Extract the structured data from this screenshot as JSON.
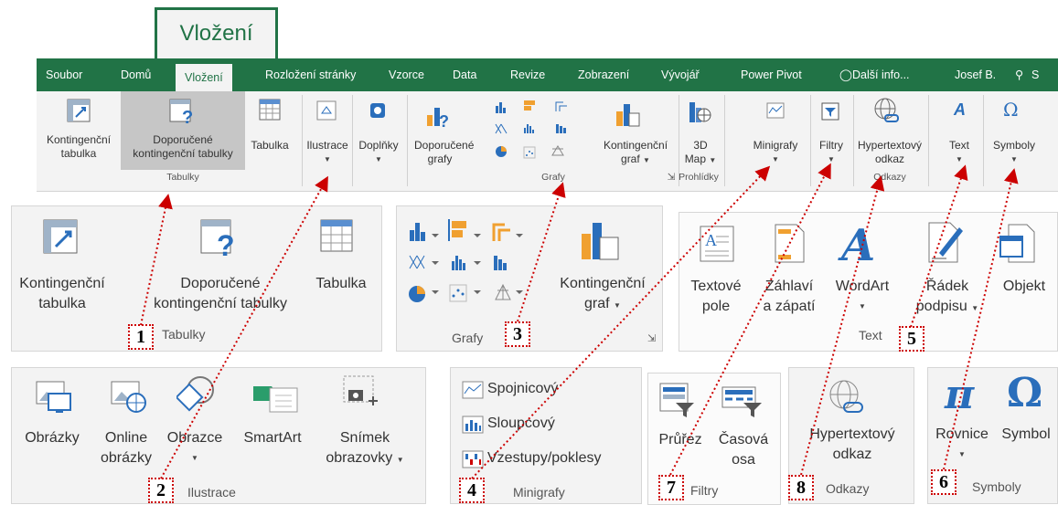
{
  "big_tab": "Vložení",
  "tabs": [
    "Soubor",
    "Domů",
    "Vložení",
    "Rozložení stránky",
    "Vzorce",
    "Data",
    "Revize",
    "Zobrazení",
    "Vývojář",
    "Power Pivot",
    "Další info...",
    "Josef B.",
    "S"
  ],
  "ribbon": {
    "kontingencni_tabulka": [
      "Kontingenční",
      "tabulka"
    ],
    "doporucene_kt": [
      "Doporučené",
      "kontingenční tabulky"
    ],
    "tabulka": "Tabulka",
    "ilustrace": "Ilustrace",
    "doplnky": "Doplňky",
    "doporucene_grafy": [
      "Doporučené",
      "grafy"
    ],
    "kontingencni_graf": [
      "Kontingenční",
      "graf"
    ],
    "map3d": [
      "3D",
      "Map"
    ],
    "minigrafy": "Minigrafy",
    "filtry": "Filtry",
    "hypertext": [
      "Hypertextový",
      "odkaz"
    ],
    "text": "Text",
    "symboly": "Symboly",
    "groups": {
      "tabulky": "Tabulky",
      "grafy": "Grafy",
      "prohlidky": "Prohlídky",
      "odkazy": "Odkazy"
    }
  },
  "panel1": {
    "kt": [
      "Kontingenční",
      "tabulka"
    ],
    "dkt": [
      "Doporučené",
      "kontingenční tabulky"
    ],
    "tab": "Tabulka",
    "group": "Tabulky",
    "num": "1"
  },
  "panel2": {
    "items": [
      [
        "Obrázky",
        ""
      ],
      [
        "Online",
        "obrázky"
      ],
      [
        "Obrazce",
        ""
      ],
      [
        "SmartArt",
        ""
      ],
      [
        "Snímek",
        "obrazovky"
      ]
    ],
    "group": "Ilustrace",
    "num": "2"
  },
  "panel3": {
    "kg": [
      "Kontingenční",
      "graf"
    ],
    "group": "Grafy",
    "num": "3"
  },
  "panel4": {
    "items": [
      "Spojnicový",
      "Sloupcový",
      "Vzestupy/poklesy"
    ],
    "group": "Minigrafy",
    "num": "4"
  },
  "panel5": {
    "items": [
      [
        "Textové",
        "pole"
      ],
      [
        "Záhlaví",
        "a zápatí"
      ],
      [
        "WordArt",
        ""
      ],
      [
        "Řádek",
        "podpisu"
      ],
      [
        "Objekt",
        ""
      ]
    ],
    "group": "Text",
    "num": "5"
  },
  "panel6": {
    "items": [
      "Rovnice",
      "Symbol"
    ],
    "group": "Symboly",
    "num": "6"
  },
  "panel7": {
    "items": [
      "Průřez",
      [
        "Časová",
        "osa"
      ]
    ],
    "group": "Filtry",
    "num": "7"
  },
  "panel8": {
    "items": [
      "Hypertextový",
      "odkaz"
    ],
    "group": "Odkazy",
    "num": "8"
  },
  "colors": {
    "excel_green": "#217346",
    "dotted_red": "#cc0000"
  }
}
